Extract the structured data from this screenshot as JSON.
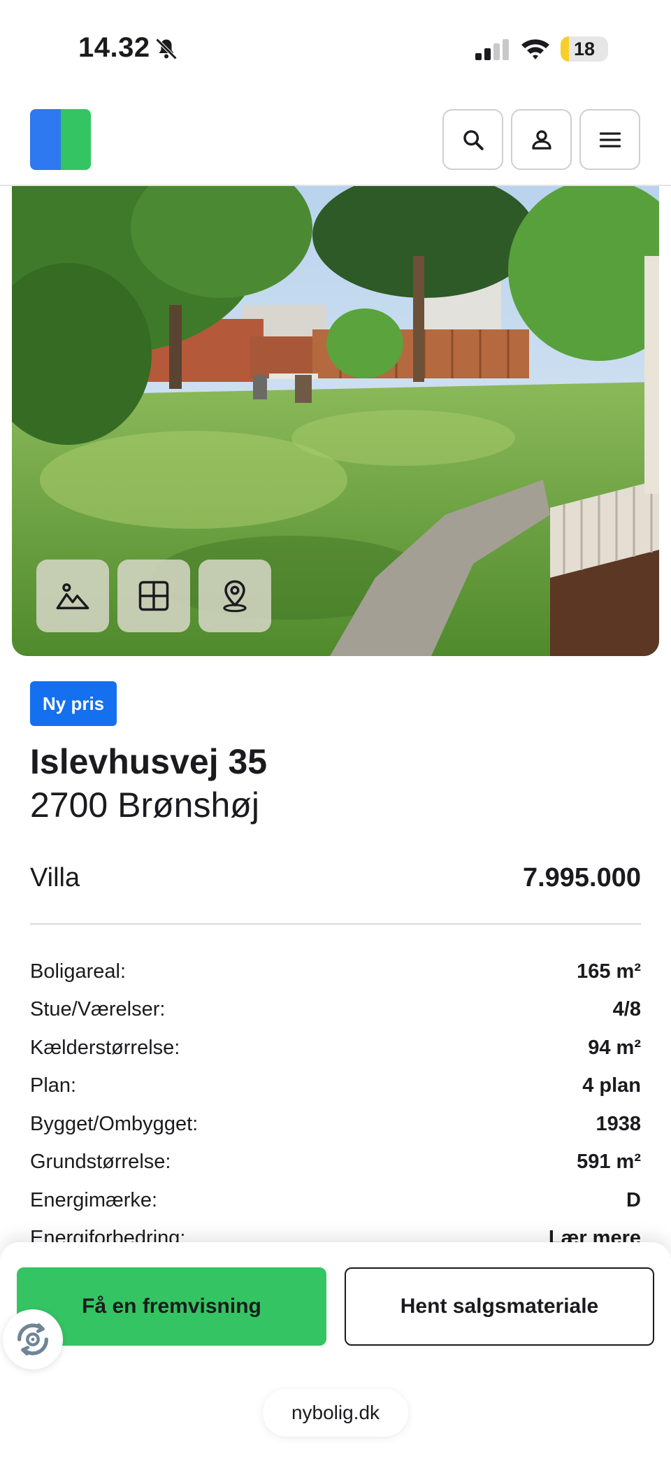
{
  "status_bar": {
    "time": "14.32",
    "battery": "18",
    "battery_level": 0.18,
    "icons": [
      "bell-off-icon",
      "signal-icon",
      "wifi-icon",
      "battery-icon"
    ]
  },
  "header": {
    "icons": [
      "search-icon",
      "user-icon",
      "menu-icon"
    ],
    "logo_colors": [
      "#2e78f0",
      "#35c463"
    ]
  },
  "gallery": {
    "buttons": [
      {
        "icon": "image-icon"
      },
      {
        "icon": "floorplan-icon"
      },
      {
        "icon": "map-pin-icon"
      }
    ]
  },
  "listing": {
    "badge": "Ny pris",
    "street": "Islevhusvej 35",
    "city": "2700 Brønshøj",
    "type": "Villa",
    "price": "7.995.000",
    "facts": [
      {
        "label": "Boligareal:",
        "value": "165 m²"
      },
      {
        "label": "Stue/Værelser:",
        "value": "4/8"
      },
      {
        "label": "Kælderstørrelse:",
        "value": "94 m²"
      },
      {
        "label": "Plan:",
        "value": "4 plan"
      },
      {
        "label": "Bygget/Ombygget:",
        "value": "1938"
      },
      {
        "label": "Grundstørrelse:",
        "value": "591 m²"
      },
      {
        "label": "Energimærke:",
        "value": "D"
      },
      {
        "label": "Energiforbedring:",
        "value": "Lær mere"
      }
    ]
  },
  "actions": {
    "primary": "Få en fremvisning",
    "secondary": "Hent salgsmateriale"
  },
  "browser": {
    "url": "nybolig.dk"
  },
  "colors": {
    "accent_green": "#35c463",
    "accent_blue": "#1470ee"
  }
}
